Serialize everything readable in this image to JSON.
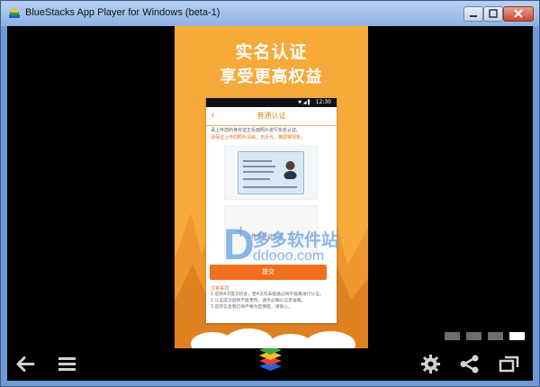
{
  "window": {
    "title": "BlueStacks App Player for Windows (beta-1)",
    "controls": [
      "minimize",
      "maximize",
      "close"
    ]
  },
  "phone": {
    "headline1": "实名认证",
    "headline2": "享受更高权益",
    "screen": {
      "status_time": "12:30",
      "status_icons": "▼ ◢ ▌",
      "nav_title": "普通认证",
      "hint1": "请上传您的身份证正反面照片进行实名认证。",
      "hint2": "请保证上传的照片清晰、无反光、横屏等现象。",
      "upload_label": "上传身份证正面",
      "submit_label": "提交",
      "notes_title": "注意事项:",
      "notes": [
        "1.您有4次提交机会，若4次均未能通过将不能再进行认证。",
        "2.认证成功后将不能更改，请务必确认信息准确。",
        "3.您的信息我们将严格为您保密，请放心。"
      ]
    }
  },
  "watermark": {
    "text": "多多软件站",
    "url": "ddooo.com"
  },
  "carousel": {
    "count": 4,
    "active_index": 3
  },
  "toolbar": {
    "icons": [
      "back-arrow-icon",
      "menu-icon",
      "bluestacks-logo-icon",
      "settings-gear-icon",
      "share-icon",
      "window-mode-icon"
    ]
  }
}
